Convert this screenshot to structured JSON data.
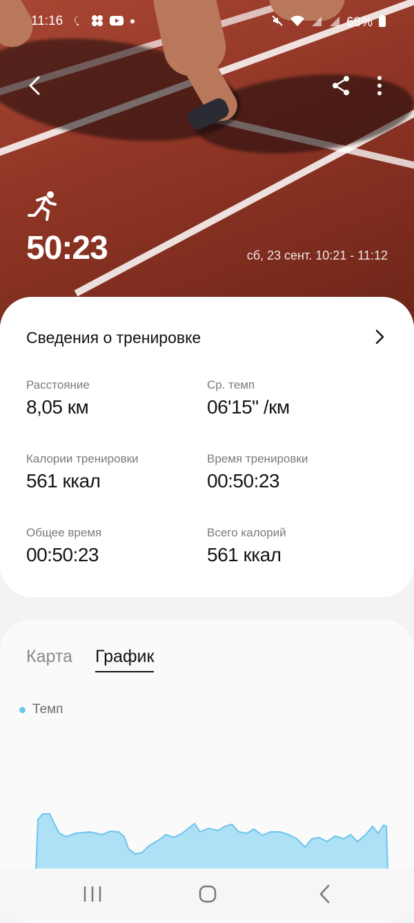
{
  "status_bar": {
    "time": "11:16",
    "battery": "68%",
    "icons": [
      "chat-icon",
      "grid-icon",
      "youtube-icon",
      "dot-icon",
      "vibrate-icon",
      "mute-icon",
      "wifi-icon",
      "signal-icon",
      "signal-icon-2",
      "battery-icon"
    ]
  },
  "workout": {
    "duration": "50:23",
    "date_range": "сб, 23 сент. 10:21 - 11:12",
    "activity_icon": "running-icon"
  },
  "details": {
    "title": "Сведения о тренировке",
    "stats": [
      {
        "label": "Расстояние",
        "value": "8,05 км"
      },
      {
        "label": "Ср. темп",
        "value": "06'15\" /км"
      },
      {
        "label": "Калории тренировки",
        "value": "561 ккал"
      },
      {
        "label": "Время тренировки",
        "value": "00:50:23"
      },
      {
        "label": "Общее время",
        "value": "00:50:23"
      },
      {
        "label": "Всего калорий",
        "value": "561 ккал"
      }
    ]
  },
  "tabs": {
    "map": "Карта",
    "graph": "График",
    "selected": "graph"
  },
  "chart": {
    "legend": "Темп",
    "color": "#6bc5ec"
  },
  "colors": {
    "hero": "#9c3e2d",
    "accent": "#6bc5ec"
  }
}
